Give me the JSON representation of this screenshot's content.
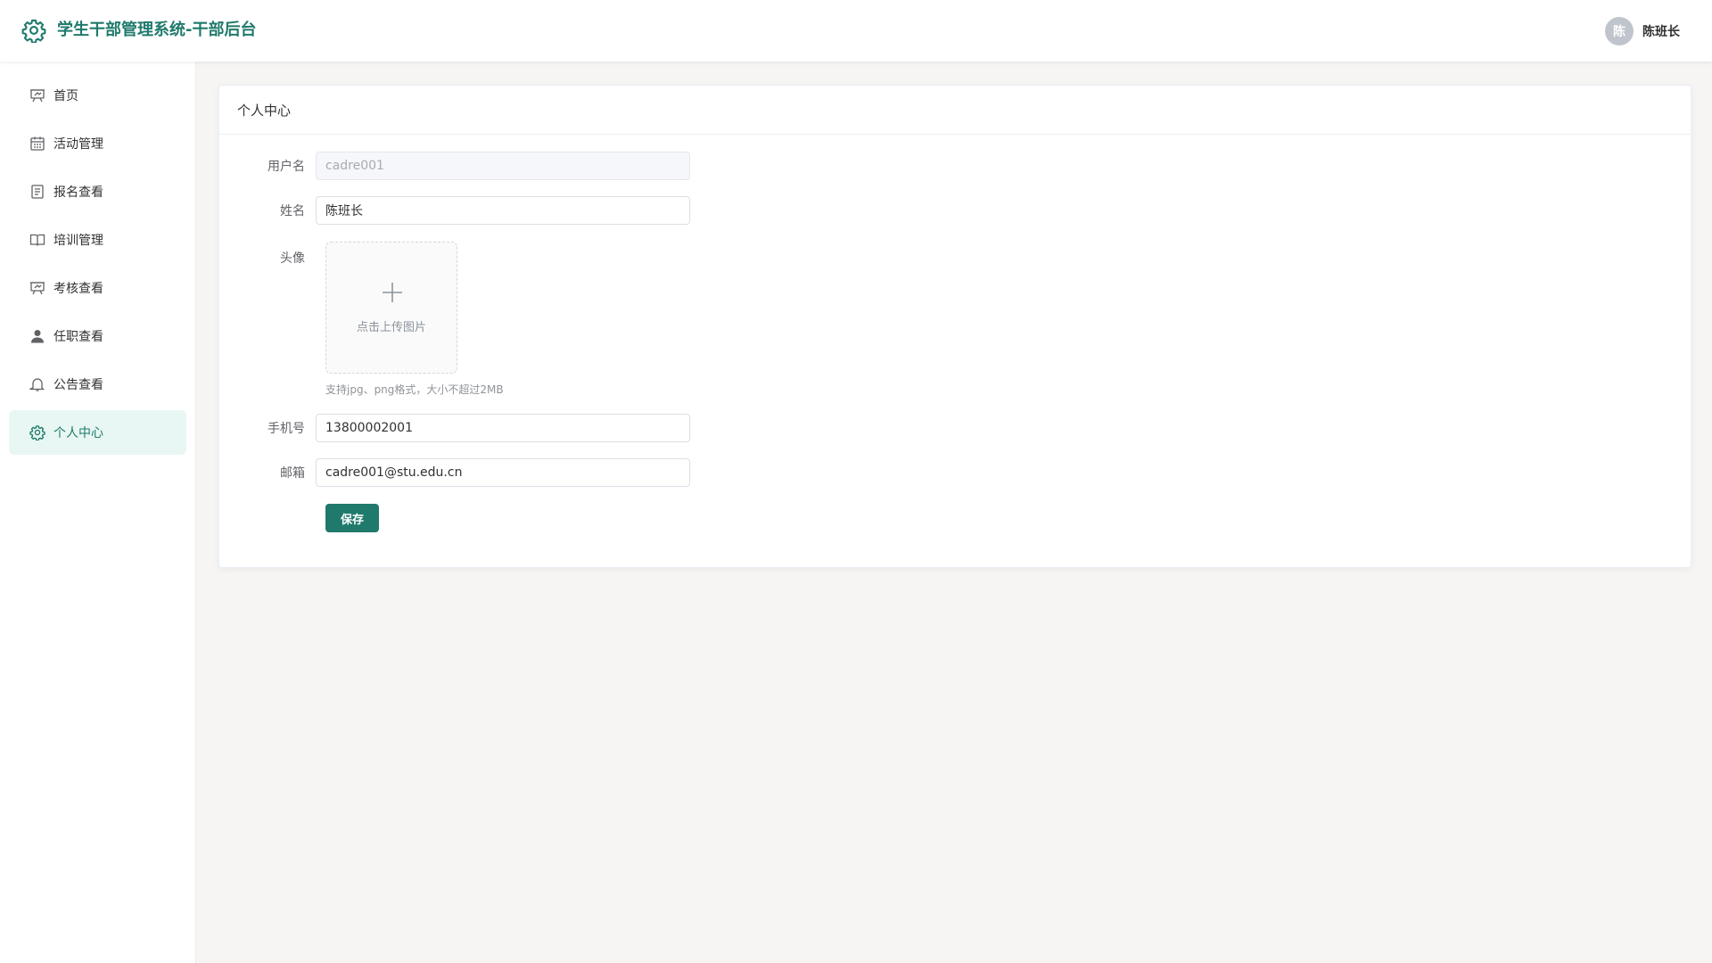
{
  "app": {
    "title": "学生干部管理系统-干部后台"
  },
  "user": {
    "avatar_text": "陈",
    "name": "陈班长"
  },
  "sidebar": {
    "items": [
      {
        "label": "首页",
        "icon": "presentation-icon"
      },
      {
        "label": "活动管理",
        "icon": "calendar-icon"
      },
      {
        "label": "报名查看",
        "icon": "document-icon"
      },
      {
        "label": "培训管理",
        "icon": "book-icon"
      },
      {
        "label": "考核查看",
        "icon": "presentation-icon"
      },
      {
        "label": "任职查看",
        "icon": "user-icon"
      },
      {
        "label": "公告查看",
        "icon": "bell-icon"
      },
      {
        "label": "个人中心",
        "icon": "gear-icon",
        "active": true
      }
    ]
  },
  "card": {
    "title": "个人中心"
  },
  "form": {
    "username": {
      "label": "用户名",
      "value": "cadre001"
    },
    "name": {
      "label": "姓名",
      "value": "陈班长"
    },
    "avatar": {
      "label": "头像",
      "upload_text": "点击上传图片",
      "hint": "支持jpg、png格式，大小不超过2MB"
    },
    "phone": {
      "label": "手机号",
      "value": "13800002001"
    },
    "email": {
      "label": "邮箱",
      "value": "cadre001@stu.edu.cn"
    },
    "save_label": "保存"
  },
  "colors": {
    "accent": "#1f7a6c",
    "active_bg": "#e8f7f3"
  }
}
